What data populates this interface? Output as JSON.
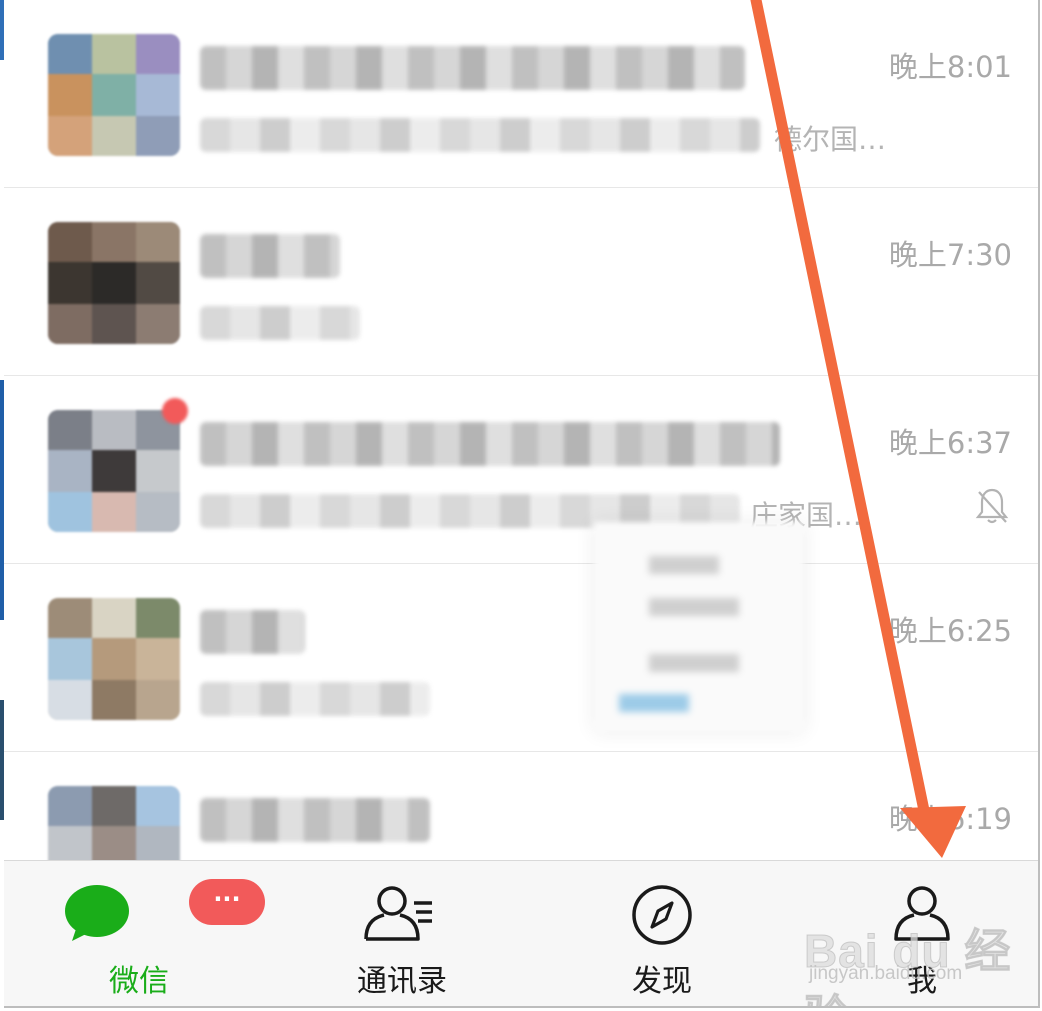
{
  "chats": [
    {
      "time": "晚上8:01",
      "preview_tail": "德尔国…",
      "muted": false,
      "unread": false
    },
    {
      "time": "晚上7:30",
      "preview_tail": "",
      "muted": false,
      "unread": false
    },
    {
      "time": "晚上6:37",
      "preview_tail": "庄家国…",
      "muted": true,
      "unread": true
    },
    {
      "time": "晚上6:25",
      "preview_tail": "",
      "muted": false,
      "unread": false
    },
    {
      "time": "晚上6:19",
      "preview_tail": "",
      "muted": false,
      "unread": false
    }
  ],
  "tabbar": {
    "tabs": [
      {
        "label": "微信",
        "icon": "chat-bubbles-icon",
        "active": true,
        "badge": "···"
      },
      {
        "label": "通讯录",
        "icon": "contacts-icon",
        "active": false
      },
      {
        "label": "发现",
        "icon": "compass-icon",
        "active": false
      },
      {
        "label": "我",
        "icon": "person-icon",
        "active": false
      }
    ]
  },
  "watermark": {
    "brand": "Bai du 经验",
    "url": "jingyan.baidu.com"
  },
  "colors": {
    "accent_green": "#1aad19",
    "badge_red": "#f25a5a",
    "arrow": "#f26a3e",
    "muted_text": "#a9a9a9"
  }
}
